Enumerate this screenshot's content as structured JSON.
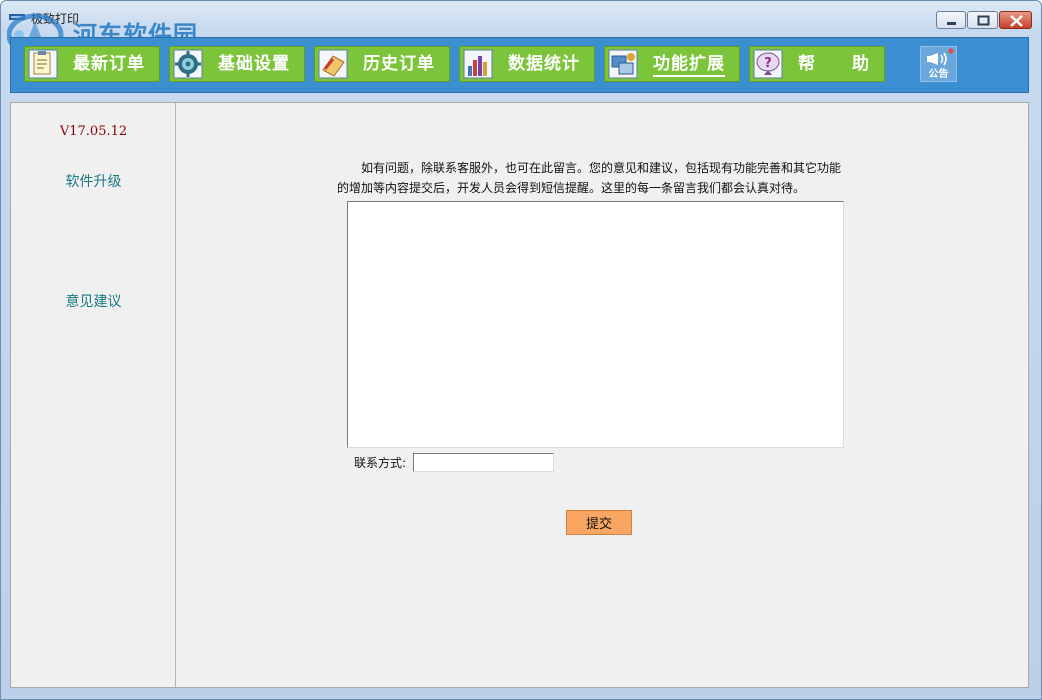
{
  "window": {
    "title": "极致打印",
    "controls": {
      "minimize": "minimize-icon",
      "maximize": "maximize-icon",
      "close": "close-icon"
    }
  },
  "watermark": {
    "text": "河东软件园",
    "url": "www.pc0359.cn"
  },
  "toolbar": {
    "items": [
      {
        "label": "最新订单",
        "icon": "clipboard-icon"
      },
      {
        "label": "基础设置",
        "icon": "gear-icon"
      },
      {
        "label": "历史订单",
        "icon": "history-icon"
      },
      {
        "label": "数据统计",
        "icon": "bar-chart-icon"
      },
      {
        "label": "功能扩展",
        "icon": "extension-icon",
        "active": true
      },
      {
        "label": "帮　　助",
        "icon": "help-icon"
      }
    ],
    "notice": {
      "label": "公告",
      "icon": "megaphone-icon"
    }
  },
  "sidebar": {
    "version": "V17.05.12",
    "links": [
      "软件升级",
      "意见建议"
    ]
  },
  "feedback": {
    "description": "如有问题，除联系客服外，也可在此留言。您的意见和建议，包括现有功能完善和其它功能的增加等内容提交后，开发人员会得到短信提醒。这里的每一条留言我们都会认真对待。",
    "message_value": "",
    "contact_label": "联系方式:",
    "contact_value": "",
    "submit_label": "提交"
  },
  "colors": {
    "toolbar_bg": "#3b8ed0",
    "button_green": "#7cc53a",
    "version_text": "#8b0000",
    "link_text": "#1a7a80",
    "submit_bg": "#f8a661"
  }
}
